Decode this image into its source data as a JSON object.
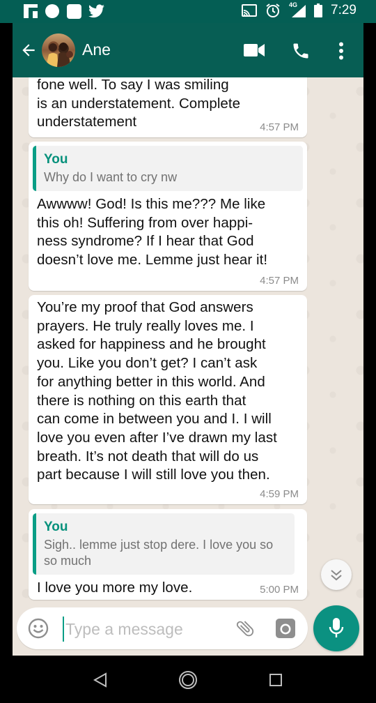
{
  "status_bar": {
    "time": "7:29",
    "network_label": "4G"
  },
  "header": {
    "contact_name": "Ane"
  },
  "messages": [
    {
      "text": "fone well. To say I was smiling\nis an understatement. Complete\nunderstatement",
      "time": "4:57 PM"
    },
    {
      "quote_name": "You",
      "quote_text": "Why do I want to cry nw",
      "text": "Awwww! God! Is this me??? Me like\nthis oh! Suffering from over happi-\nness syndrome? If I hear that God\ndoesn’t love me. Lemme just hear it!",
      "time": "4:57 PM"
    },
    {
      "text": "You’re my proof that God answers\nprayers. He truly really loves me. I\nasked for happiness and he brought\nyou. Like you don’t get? I can’t ask\nfor anything better in this world. And\nthere is nothing on this earth that\ncan come in between you and I. I will\nlove you even after I’ve drawn my last\nbreath. It’s not death that will do us\npart because I will still love you then.",
      "time": "4:59 PM"
    },
    {
      "quote_name": "You",
      "quote_text": "Sigh.. lemme just stop dere.  I love you so\nso much",
      "text": "I love you more my love.",
      "time": "5:00 PM"
    }
  ],
  "composer": {
    "placeholder": "Type a message"
  },
  "colors": {
    "header": "#075e54",
    "status_bar": "#045e54",
    "accent": "#0a9e86",
    "chat_background": "#ece5dd",
    "bubble": "#ffffff"
  },
  "icons": {
    "status_left": [
      "flipboard-icon",
      "circle-notification-icon",
      "square-notification-icon",
      "twitter-icon"
    ],
    "status_right": [
      "cast-icon",
      "alarm-icon",
      "signal-icon",
      "battery-icon"
    ],
    "header": [
      "back-arrow-icon",
      "video-call-icon",
      "phone-icon",
      "more-vert-icon"
    ],
    "composer": [
      "emoji-icon",
      "attach-icon",
      "camera-icon",
      "mic-icon"
    ],
    "nav": [
      "nav-back-icon",
      "nav-home-icon",
      "nav-recents-icon"
    ]
  }
}
